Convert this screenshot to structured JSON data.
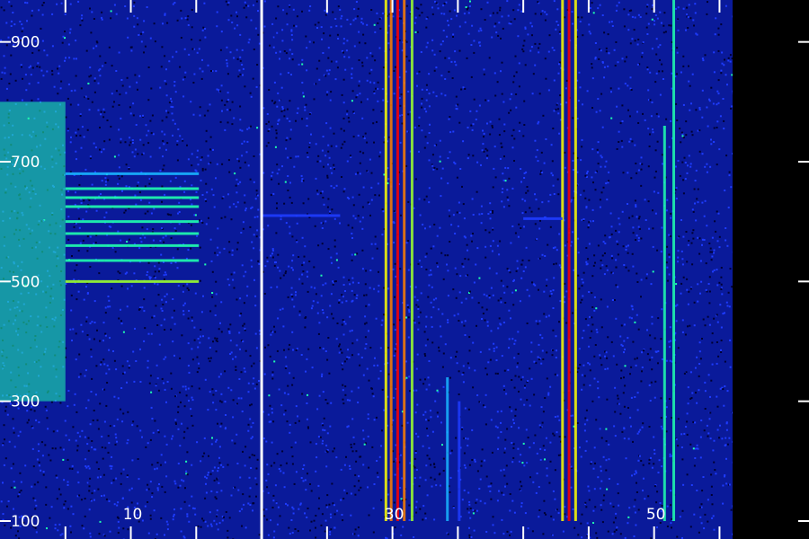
{
  "chart_data": {
    "type": "heatmap",
    "colormap": [
      "#000033",
      "#0000aa",
      "#1e3cff",
      "#19b4ff",
      "#20ffb0",
      "#9cff2e",
      "#ffff00",
      "#ff8000",
      "#ff0000"
    ],
    "background_color": "#0a1a9a",
    "axis_color": "#ffffff",
    "xlim": [
      0,
      56
    ],
    "ylim": [
      100,
      1000
    ],
    "x_ticks": [
      {
        "value": 10,
        "label": "10"
      },
      {
        "value": 30,
        "label": "30"
      },
      {
        "value": 50,
        "label": "50"
      }
    ],
    "y_ticks": [
      {
        "value": 100,
        "label": "100"
      },
      {
        "value": 300,
        "label": "300"
      },
      {
        "value": 500,
        "label": "500"
      },
      {
        "value": 700,
        "label": "700"
      },
      {
        "value": 900,
        "label": "900"
      }
    ],
    "x_minor_ticks": [
      5,
      15,
      20,
      25,
      35,
      40,
      45,
      55
    ],
    "grid": false,
    "data_gap_x": 20,
    "features": [
      {
        "kind": "diffuse",
        "x": [
          0,
          5
        ],
        "y": [
          300,
          800
        ],
        "intensity": 0.45
      },
      {
        "kind": "hline",
        "x": [
          5,
          15.2
        ],
        "y": 500,
        "intensity": 0.6
      },
      {
        "kind": "hline",
        "x": [
          5,
          15.2
        ],
        "y": 535,
        "intensity": 0.45
      },
      {
        "kind": "hline",
        "x": [
          5,
          15.2
        ],
        "y": 560,
        "intensity": 0.45
      },
      {
        "kind": "hline",
        "x": [
          5,
          15.2
        ],
        "y": 580,
        "intensity": 0.5
      },
      {
        "kind": "hline",
        "x": [
          5,
          15.2
        ],
        "y": 600,
        "intensity": 0.5
      },
      {
        "kind": "hline",
        "x": [
          5,
          15.2
        ],
        "y": 625,
        "intensity": 0.45
      },
      {
        "kind": "hline",
        "x": [
          5,
          15.2
        ],
        "y": 640,
        "intensity": 0.45
      },
      {
        "kind": "hline",
        "x": [
          5,
          15.2
        ],
        "y": 655,
        "intensity": 0.5
      },
      {
        "kind": "hline",
        "x": [
          5,
          15.2
        ],
        "y": 680,
        "intensity": 0.35
      },
      {
        "kind": "vline",
        "x": 29.5,
        "y": [
          100,
          1000
        ],
        "intensity": 0.7
      },
      {
        "kind": "vline",
        "x": 29.9,
        "y": [
          100,
          1000
        ],
        "intensity": 0.9
      },
      {
        "kind": "vline",
        "x": 30.4,
        "y": [
          100,
          1000
        ],
        "intensity": 0.95
      },
      {
        "kind": "vline",
        "x": 30.9,
        "y": [
          100,
          1000
        ],
        "intensity": 0.85
      },
      {
        "kind": "vline",
        "x": 31.5,
        "y": [
          100,
          1000
        ],
        "intensity": 0.65
      },
      {
        "kind": "vline",
        "x": 34.2,
        "y": [
          100,
          340
        ],
        "intensity": 0.35
      },
      {
        "kind": "vline",
        "x": 35.1,
        "y": [
          100,
          300
        ],
        "intensity": 0.3
      },
      {
        "kind": "vline",
        "x": 43.0,
        "y": [
          100,
          1000
        ],
        "intensity": 0.8
      },
      {
        "kind": "vline",
        "x": 43.5,
        "y": [
          100,
          1000
        ],
        "intensity": 0.95
      },
      {
        "kind": "vline",
        "x": 44.0,
        "y": [
          100,
          1000
        ],
        "intensity": 0.7
      },
      {
        "kind": "vline",
        "x": 50.8,
        "y": [
          100,
          760
        ],
        "intensity": 0.45
      },
      {
        "kind": "vline",
        "x": 51.5,
        "y": [
          100,
          1000
        ],
        "intensity": 0.55
      },
      {
        "kind": "hline",
        "x": [
          40,
          43
        ],
        "y": 605,
        "intensity": 0.3
      },
      {
        "kind": "hline",
        "x": [
          20,
          26
        ],
        "y": 610,
        "intensity": 0.25
      }
    ]
  }
}
